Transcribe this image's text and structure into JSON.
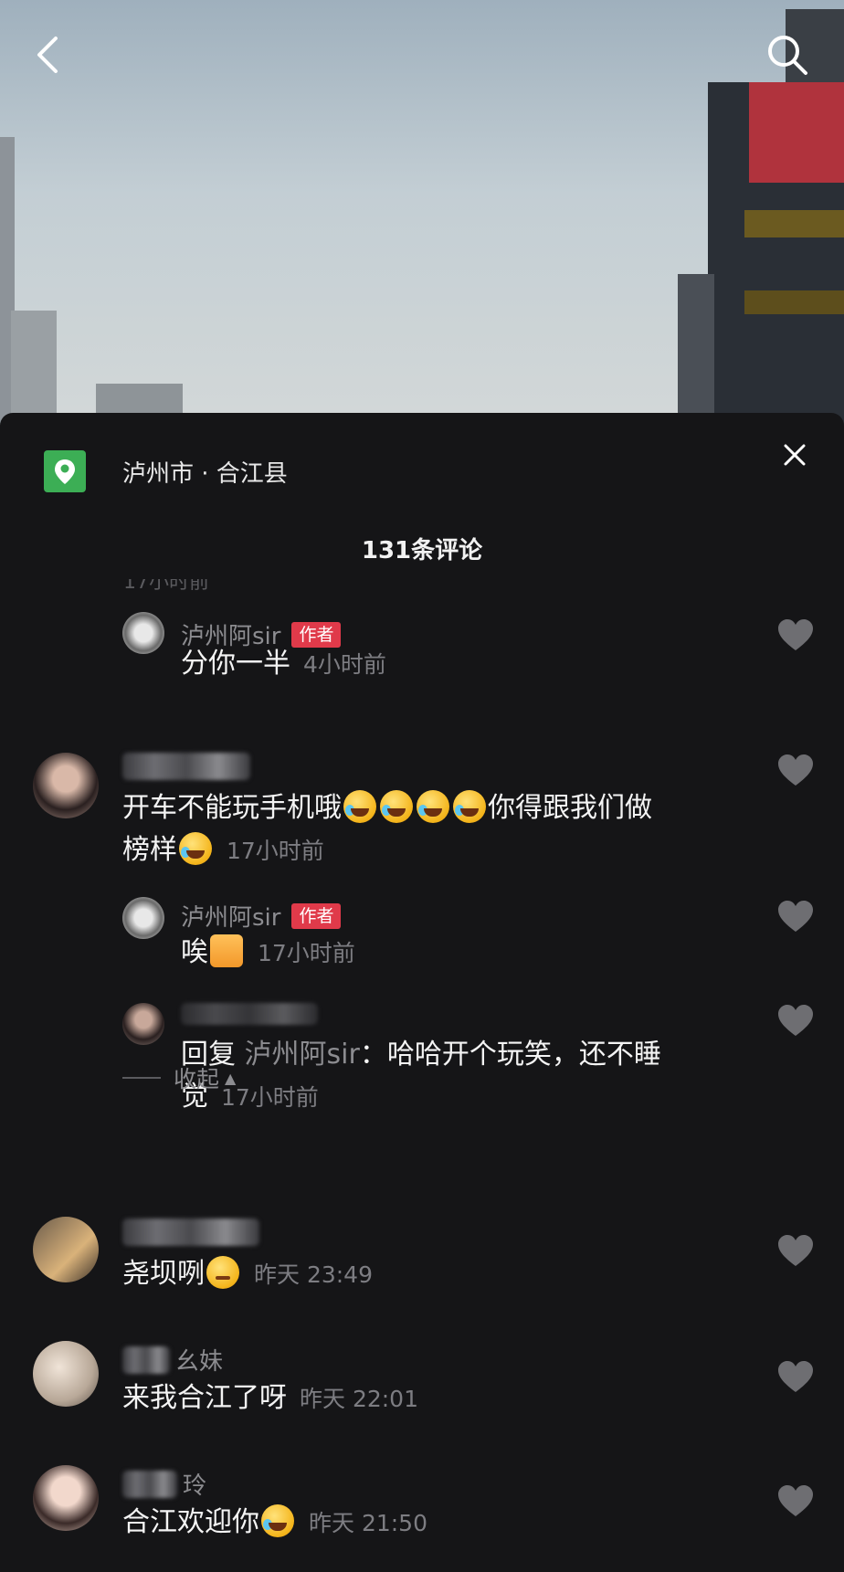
{
  "header": {
    "back_icon": "chevron-left-icon",
    "search_icon": "search-icon"
  },
  "sheet": {
    "location": "泸州市 · 合江县",
    "location_icon": "map-pin-icon",
    "comment_count": "131条评论",
    "close_icon": "close-icon",
    "cut_time": "17小时前"
  },
  "comments": [
    {
      "name": "泸州阿sir",
      "tag": "作者",
      "text": "分你一半",
      "time": "4小时前"
    },
    {
      "name": "",
      "text1": "开车不能玩手机哦",
      "text2": "你得跟我们做",
      "text3": "榜样",
      "time": "17小时前"
    },
    {
      "name": "泸州阿sir",
      "tag": "作者",
      "text": "唉",
      "time": "17小时前"
    },
    {
      "name": "",
      "reply_prefix": "回复",
      "reply_name": "泸州阿sir",
      "text1": "：哈哈开个玩笑，还不睡",
      "text2": "觉",
      "time": "17小时前"
    },
    {
      "name": "",
      "text": "尧坝咧",
      "time": "昨天 23:49"
    },
    {
      "name": "幺妹",
      "text": "来我合江了呀",
      "time": "昨天 22:01"
    },
    {
      "name": "玲",
      "text": "合江欢迎你",
      "time": "昨天 21:50"
    }
  ],
  "collapse_label": "收起",
  "colors": {
    "sheet_bg": "#151517",
    "author_tag": "#e03a4a",
    "location_green": "#3cae55"
  }
}
